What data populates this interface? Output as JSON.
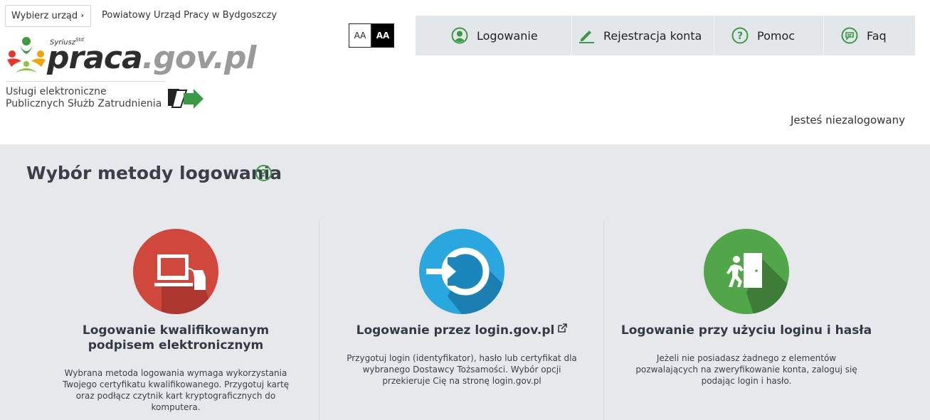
{
  "header": {
    "office_button": "Wybierz urząd",
    "office_name": "Powiatowy Urząd Pracy w Bydgoszczy",
    "logo_part1": "praca",
    "logo_part2": ".gov.pl",
    "logo_sub": "Syriusz",
    "logo_sub_sup": "Std",
    "services_line1": "Usługi elektroniczne",
    "services_line2": "Publicznych Służb Zatrudnienia",
    "contrast_normal": "AA",
    "contrast_high": "AA",
    "nav": [
      {
        "label": "Logowanie",
        "icon": "user-circle-icon"
      },
      {
        "label": "Rejestracja konta",
        "icon": "pencil-icon"
      },
      {
        "label": "Pomoc",
        "icon": "question-circle-icon"
      },
      {
        "label": "Faq",
        "icon": "chat-icon"
      }
    ],
    "status": "Jesteś niezalogowany"
  },
  "main": {
    "title": "Wybór metody logowania",
    "methods": [
      {
        "title": "Logowanie kwalifikowanym podpisem elektronicznym",
        "description": "Wybrana metoda logowania wymaga wykorzystania Twojego certyfikatu kwalifikowanego. Przygotuj kartę oraz podłącz czytnik kart kryptograficznych do komputera.",
        "color": "#d0473c",
        "icon": "computer-card-reader-icon"
      },
      {
        "title": "Logowanie przez login.gov.pl",
        "description": "Przygotuj login (identyfikator), hasło lub certyfikat dla wybranego Dostawcy Tożsamości. Wybór opcji przekieruje Cię na stronę login.gov.pl",
        "color": "#2ba7e0",
        "icon": "login-arrow-icon"
      },
      {
        "title": "Logowanie przy użyciu loginu i hasła",
        "description": "Jeżeli nie posiadasz żadnego z elementów pozwalających na zweryfikowanie konta, zaloguj się podając login i hasło.",
        "color": "#52a64a",
        "icon": "person-door-icon"
      }
    ]
  },
  "colors": {
    "accent_green": "#3a9a45",
    "nav_bg": "#e4e7ea",
    "main_bg": "#e6e8ec"
  }
}
